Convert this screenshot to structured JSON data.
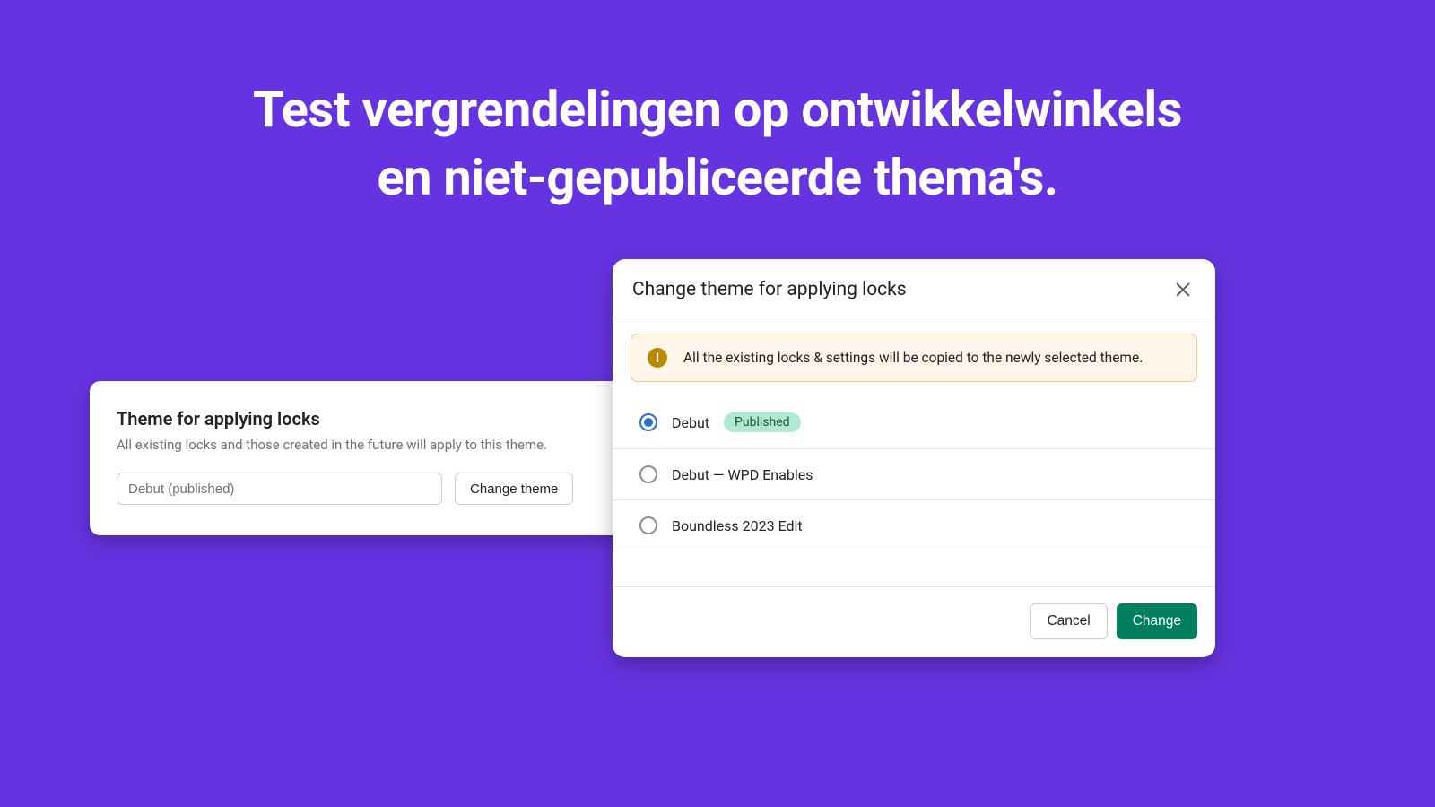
{
  "hero": {
    "line1": "Test vergrendelingen op ontwikkelwinkels",
    "line2": "en niet-gepubliceerde thema's."
  },
  "card": {
    "title": "Theme for applying locks",
    "subtitle": "All existing locks and those created in the future will apply to this theme.",
    "input_value": "Debut (published)",
    "change_button": "Change theme"
  },
  "modal": {
    "title": "Change theme for applying locks",
    "banner": "All the existing locks & settings will be copied to the newly selected theme.",
    "options": [
      {
        "label": "Debut",
        "badge": "Published",
        "selected": true
      },
      {
        "label": "Debut — WPD Enables",
        "badge": null,
        "selected": false
      },
      {
        "label": "Boundless 2023 Edit",
        "badge": null,
        "selected": false
      }
    ],
    "cancel": "Cancel",
    "confirm": "Change"
  }
}
